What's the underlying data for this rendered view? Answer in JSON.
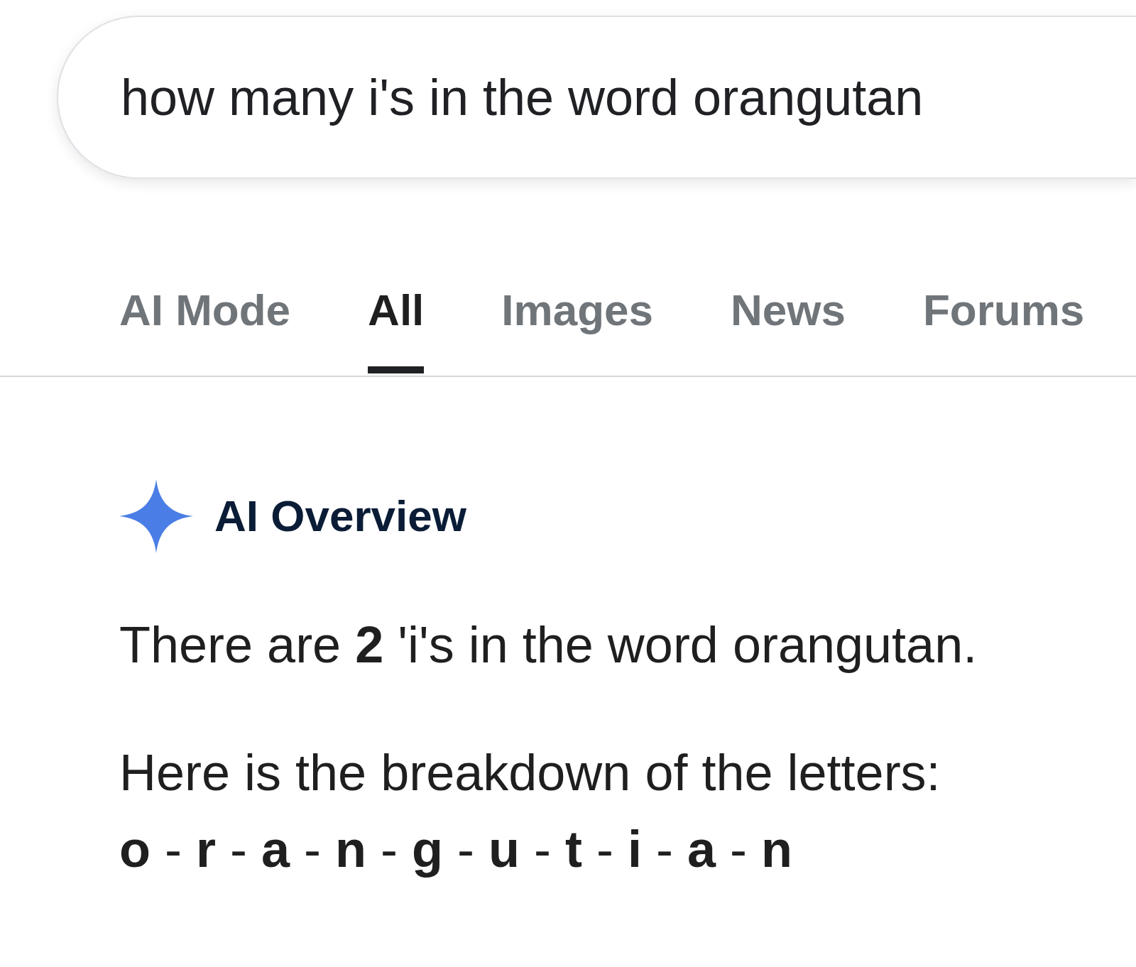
{
  "search": {
    "value": "how many i's in the word orangutan"
  },
  "tabs": [
    {
      "label": "AI Mode",
      "selected": false
    },
    {
      "label": "All",
      "selected": true
    },
    {
      "label": "Images",
      "selected": false
    },
    {
      "label": "News",
      "selected": false
    },
    {
      "label": "Forums",
      "selected": false
    }
  ],
  "ai_overview": {
    "title": "AI Overview",
    "paragraphs": [
      "There are **2** 'i's in the word orangutan.",
      "Here is the breakdown of the letters:"
    ],
    "breakdown": "**o** - **r** - **a** - **n** - **g** - **u** - **t** - **i** - **a** - **n**"
  }
}
